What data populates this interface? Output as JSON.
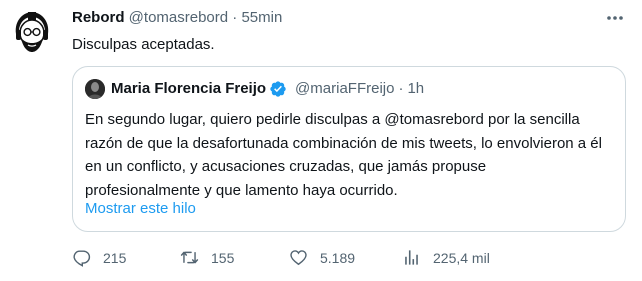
{
  "tweet": {
    "author_name": "Rebord",
    "author_handle": "@tomasrebord",
    "separator": "·",
    "time": "55min",
    "text": "Disculpas aceptadas."
  },
  "quoted_tweet": {
    "author_name": "Maria Florencia Freijo",
    "author_handle": "@mariaFFreijo",
    "separator": "·",
    "time": "1h",
    "text": "En segundo lugar, quiero pedirle disculpas a @tomasrebord por la sencilla razón de que la desafortunada combinación de mis tweets, lo envolvieron a él en un conflicto, y acusaciones cruzadas, que jamás propuse profesionalmente y que lamento haya ocurrido.",
    "show_thread_label": "Mostrar este hilo"
  },
  "actions": {
    "replies": "215",
    "retweets": "155",
    "likes": "5.189",
    "views": "225,4 mil"
  },
  "icons": {
    "more": "more-icon",
    "verified": "verified-badge-icon",
    "reply": "reply-icon",
    "retweet": "retweet-icon",
    "like": "heart-icon",
    "views": "analytics-icon"
  },
  "colors": {
    "link": "#1d9bf0",
    "muted": "#536471",
    "text": "#0f1419",
    "border": "#cfd9de"
  }
}
